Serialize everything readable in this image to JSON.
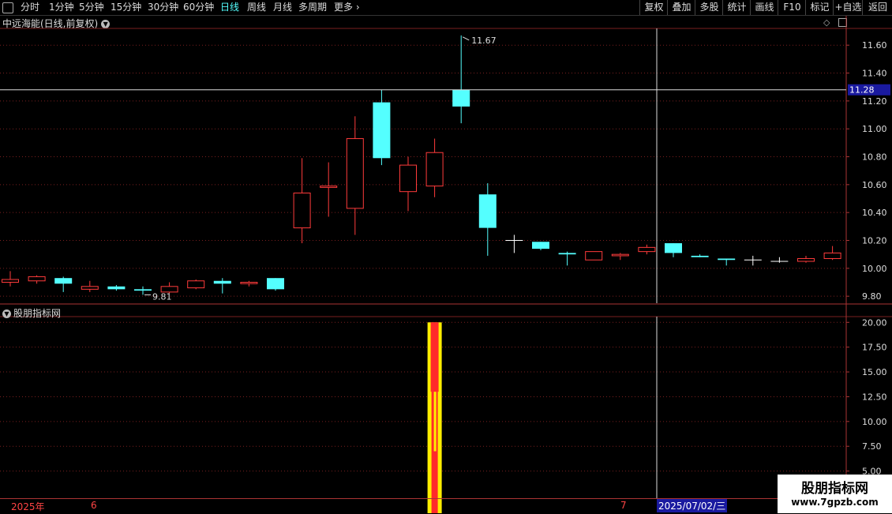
{
  "toolbar": {
    "tabs": [
      "分时",
      "1分钟",
      "5分钟",
      "15分钟",
      "30分钟",
      "60分钟",
      "日线",
      "周线",
      "月线",
      "多周期",
      "更多"
    ],
    "active": "日线",
    "right_buttons": [
      "复权",
      "叠加",
      "多股",
      "统计",
      "画线",
      "F10",
      "标记",
      "+自选",
      "返回"
    ]
  },
  "main_title": "中远海能(日线,前复权)",
  "price_axis": [
    "11.60",
    "11.40",
    "11.20",
    "11.00",
    "10.80",
    "10.60",
    "10.40",
    "10.20",
    "10.00",
    "9.80"
  ],
  "cursor_price": "11.28",
  "max_label": "11.67",
  "min_label": "9.81",
  "indicator_title": "股朋指标网",
  "indicator_axis": [
    "20.00",
    "17.50",
    "15.00",
    "12.50",
    "10.00",
    "7.50",
    "5.00"
  ],
  "date_axis": {
    "year": "2025年",
    "m6": "6",
    "m7": "7",
    "cursor_date": "2025/07/02/三"
  },
  "watermark": {
    "line1": "股朋指标网",
    "line2": "www.7gpzb.com"
  },
  "colors": {
    "up": "#ff3b3b",
    "down": "#54ffff",
    "flat": "#ffffff",
    "grid": "#7a1f1f"
  },
  "chart_data": {
    "type": "candlestick",
    "candles": [
      {
        "o": 9.9,
        "h": 9.98,
        "l": 9.87,
        "c": 9.92
      },
      {
        "o": 9.91,
        "h": 9.95,
        "l": 9.89,
        "c": 9.94
      },
      {
        "o": 9.93,
        "h": 9.94,
        "l": 9.83,
        "c": 9.89
      },
      {
        "o": 9.85,
        "h": 9.91,
        "l": 9.83,
        "c": 9.87
      },
      {
        "o": 9.87,
        "h": 9.88,
        "l": 9.84,
        "c": 9.85
      },
      {
        "o": 9.85,
        "h": 9.87,
        "l": 9.81,
        "c": 9.84
      },
      {
        "o": 9.83,
        "h": 9.9,
        "l": 9.82,
        "c": 9.87
      },
      {
        "o": 9.86,
        "h": 9.92,
        "l": 9.85,
        "c": 9.91
      },
      {
        "o": 9.91,
        "h": 9.93,
        "l": 9.82,
        "c": 9.89
      },
      {
        "o": 9.89,
        "h": 9.91,
        "l": 9.87,
        "c": 9.9
      },
      {
        "o": 9.93,
        "h": 9.93,
        "l": 9.84,
        "c": 9.85
      },
      {
        "o": 10.29,
        "h": 10.79,
        "l": 10.18,
        "c": 10.54
      },
      {
        "o": 10.58,
        "h": 10.76,
        "l": 10.37,
        "c": 10.59
      },
      {
        "o": 10.43,
        "h": 11.09,
        "l": 10.24,
        "c": 10.93
      },
      {
        "o": 11.19,
        "h": 11.28,
        "l": 10.74,
        "c": 10.79
      },
      {
        "o": 10.55,
        "h": 10.8,
        "l": 10.41,
        "c": 10.74
      },
      {
        "o": 10.59,
        "h": 10.93,
        "l": 10.51,
        "c": 10.83
      },
      {
        "o": 11.28,
        "h": 11.67,
        "l": 11.04,
        "c": 11.16
      },
      {
        "o": 10.53,
        "h": 10.61,
        "l": 10.09,
        "c": 10.29
      },
      {
        "o": 10.2,
        "h": 10.24,
        "l": 10.11,
        "c": 10.2
      },
      {
        "o": 10.19,
        "h": 10.19,
        "l": 10.13,
        "c": 10.14
      },
      {
        "o": 10.11,
        "h": 10.12,
        "l": 10.02,
        "c": 10.1
      },
      {
        "o": 10.06,
        "h": 10.12,
        "l": 10.06,
        "c": 10.12
      },
      {
        "o": 10.09,
        "h": 10.11,
        "l": 10.06,
        "c": 10.1
      },
      {
        "o": 10.12,
        "h": 10.17,
        "l": 10.1,
        "c": 10.15
      },
      {
        "o": 10.18,
        "h": 10.18,
        "l": 10.08,
        "c": 10.11
      },
      {
        "o": 10.09,
        "h": 10.1,
        "l": 10.08,
        "c": 10.08
      },
      {
        "o": 10.07,
        "h": 10.07,
        "l": 10.02,
        "c": 10.06
      },
      {
        "o": 10.06,
        "h": 10.09,
        "l": 10.02,
        "c": 10.06
      },
      {
        "o": 10.05,
        "h": 10.08,
        "l": 10.04,
        "c": 10.05
      },
      {
        "o": 10.05,
        "h": 10.09,
        "l": 10.04,
        "c": 10.07
      },
      {
        "o": 10.07,
        "h": 10.16,
        "l": 10.06,
        "c": 10.11
      }
    ],
    "ylim": [
      9.75,
      11.72
    ],
    "indicator": {
      "ylim": [
        2.5,
        20.5
      ],
      "bar_index": 16,
      "outer": [
        0,
        20
      ],
      "inner_top": [
        13,
        20
      ],
      "inner_low": [
        7,
        13
      ]
    }
  }
}
